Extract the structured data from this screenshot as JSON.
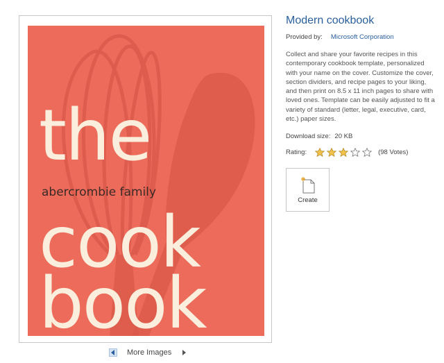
{
  "preview": {
    "cover_the": "the",
    "cover_family": "abercrombie family",
    "cover_cook": "cook",
    "cover_book": "book",
    "more_images_label": "More Images"
  },
  "template": {
    "title": "Modern cookbook",
    "provided_by_label": "Provided by:",
    "provided_by_value": "Microsoft Corporation",
    "description": "Collect and share your favorite recipes in this contemporary cookbook template, personalized with your name on the cover. Customize the cover, section dividers, and recipe pages to your liking, and then print on 8.5 x 11 inch pages to share with loved ones. Template can be easily adjusted to fit a variety of standard (letter, legal, executive, card, etc.) paper sizes.",
    "download_size_label": "Download size:",
    "download_size_value": "20 KB",
    "rating_label": "Rating:",
    "rating_value": 3,
    "rating_max": 5,
    "votes": "(98 Votes)"
  },
  "actions": {
    "create_label": "Create"
  },
  "colors": {
    "cover_bg": "#ec6b5a",
    "cover_text": "#fbeedd",
    "link": "#2a5f9e",
    "star_fill": "#f2c34a"
  }
}
